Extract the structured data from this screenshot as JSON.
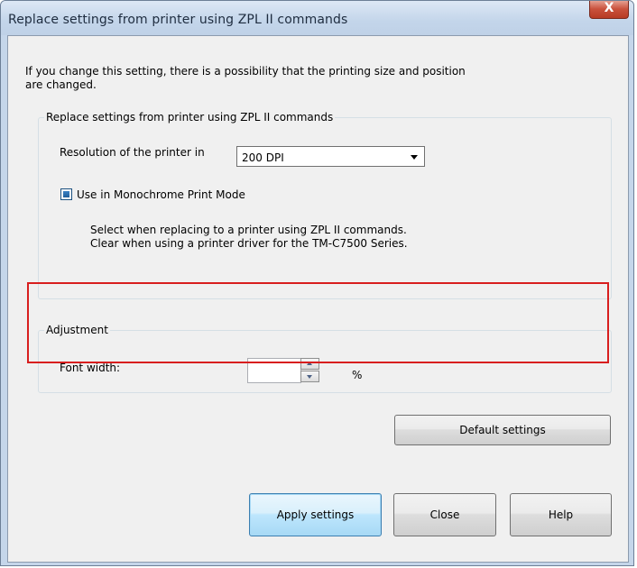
{
  "window": {
    "title": "Replace settings from printer using ZPL II commands",
    "close_glyph": "X"
  },
  "note": {
    "line1": "If you change this setting, there is a possibility that the printing size and position",
    "line2": "are changed."
  },
  "replace_group": {
    "legend": "Replace settings from printer using ZPL II commands",
    "resolution_label": "Resolution of the printer in",
    "resolution_value": "200 DPI",
    "monochrome_label": "Use in Monochrome Print Mode",
    "monochrome_checked": true,
    "hint_line1": "Select when replacing to a printer using ZPL II commands.",
    "hint_line2": "Clear when using a printer driver for the TM-C7500 Series."
  },
  "adjustment_group": {
    "legend": "Adjustment",
    "font_width_label": "Font width:",
    "font_width_value": "",
    "unit": "%"
  },
  "buttons": {
    "default_settings": "Default settings",
    "apply": "Apply settings",
    "close": "Close",
    "help": "Help"
  },
  "colors": {
    "highlight_border": "#d81e1e",
    "titlebar": "#c5d6ea",
    "client_bg": "#f0f0f0",
    "default_button_border": "#3c7fb1"
  },
  "icons": [
    "close-icon",
    "dropdown-arrow-icon",
    "spin-up-icon",
    "spin-down-icon"
  ]
}
